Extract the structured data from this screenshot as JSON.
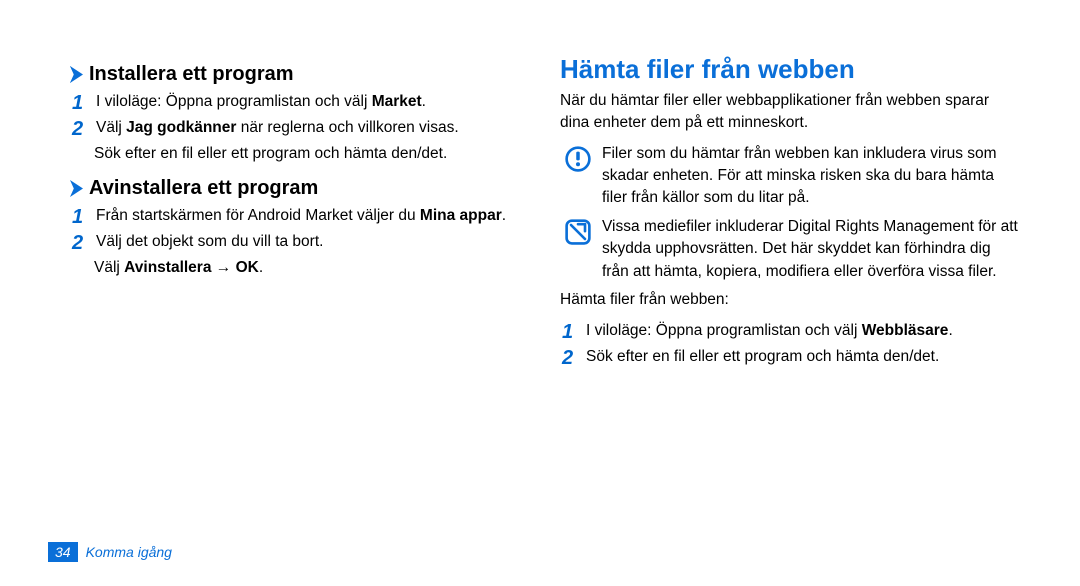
{
  "left": {
    "section1": {
      "heading": "Installera ett program",
      "steps": [
        {
          "num": "1",
          "parts": [
            "I viloläge: Öppna programlistan och välj ",
            "Market",
            "."
          ]
        },
        {
          "num": "2",
          "parts": [
            "Välj ",
            "Jag godkänner",
            " när reglerna och villkoren visas."
          ]
        }
      ],
      "after": "Sök efter en fil eller ett program och hämta den/det."
    },
    "section2": {
      "heading": "Avinstallera ett program",
      "steps": [
        {
          "num": "1",
          "parts": [
            "Från startskärmen för Android Market väljer du ",
            "Mina appar",
            "."
          ]
        },
        {
          "num": "2",
          "parts": [
            "Välj det objekt som du vill ta bort."
          ]
        }
      ],
      "after_parts": [
        "Välj ",
        "Avinstallera",
        " → ",
        "OK",
        "."
      ]
    }
  },
  "right": {
    "heading": "Hämta filer från webben",
    "intro": "När du hämtar filer eller webbapplikationer från webben sparar dina enheter dem på ett minneskort.",
    "warning": "Filer som du hämtar från webben kan inkludera virus som skadar enheten. För att minska risken ska du bara hämta filer från källor som du litar på.",
    "note": "Vissa mediefiler inkluderar Digital Rights Management för att skydda upphovsrätten. Det här skyddet kan förhindra dig från att hämta, kopiera, modifiera eller överföra vissa filer.",
    "lead": "Hämta filer från webben:",
    "steps": [
      {
        "num": "1",
        "parts": [
          "I viloläge: Öppna programlistan och välj ",
          "Webbläsare",
          "."
        ]
      },
      {
        "num": "2",
        "parts": [
          "Sök efter en fil eller ett program och hämta den/det."
        ]
      }
    ]
  },
  "footer": {
    "page": "34",
    "section": "Komma igång"
  }
}
